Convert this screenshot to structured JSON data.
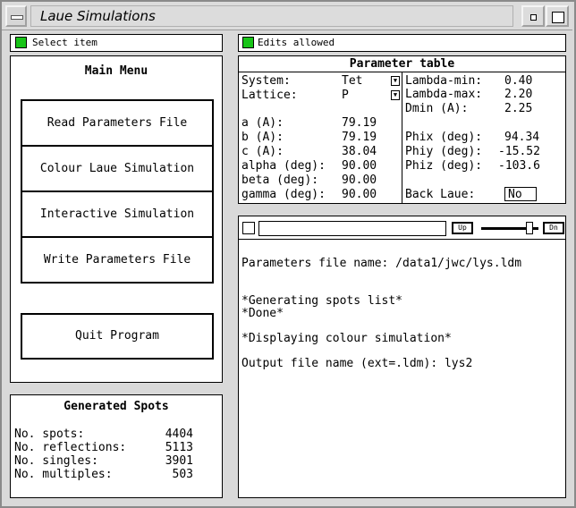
{
  "window": {
    "title": "Laue Simulations"
  },
  "left_status": {
    "text": "Select item",
    "color": "#18c418"
  },
  "right_status": {
    "text": "Edits allowed",
    "color": "#18c418"
  },
  "main_menu": {
    "title": "Main Menu",
    "buttons": [
      "Read Parameters File",
      "Colour Laue Simulation",
      "Interactive Simulation",
      "Write Parameters File"
    ],
    "quit": "Quit Program"
  },
  "generated_spots": {
    "title": "Generated Spots",
    "rows": [
      {
        "label": "No. spots:",
        "value": "4404"
      },
      {
        "label": "No. reflections:",
        "value": "5113"
      },
      {
        "label": "No. singles:",
        "value": "3901"
      },
      {
        "label": "No. multiples:",
        "value": "503"
      }
    ]
  },
  "parameter_table": {
    "title": "Parameter table",
    "system": {
      "label": "System:",
      "value": "Tet"
    },
    "lattice": {
      "label": "Lattice:",
      "value": "P"
    },
    "cell": [
      {
        "label": "a (A):",
        "value": "79.19"
      },
      {
        "label": "b (A):",
        "value": "79.19"
      },
      {
        "label": "c (A):",
        "value": "38.04"
      },
      {
        "label": "alpha (deg):",
        "value": "90.00"
      },
      {
        "label": "beta (deg):",
        "value": "90.00"
      },
      {
        "label": "gamma (deg):",
        "value": "90.00"
      }
    ],
    "lambda": [
      {
        "label": "Lambda-min:",
        "value": "0.40"
      },
      {
        "label": "Lambda-max:",
        "value": "2.20"
      },
      {
        "label": "Dmin (A):",
        "value": "2.25"
      }
    ],
    "phi": [
      {
        "label": "Phix (deg):",
        "value": "94.34"
      },
      {
        "label": "Phiy (deg):",
        "value": "-15.52"
      },
      {
        "label": "Phiz (deg):",
        "value": "-103.6"
      }
    ],
    "back_laue": {
      "label": "Back Laue:",
      "value": "No"
    }
  },
  "console": {
    "up_label": "Up",
    "down_label": "Dn",
    "slider_level": 0.9,
    "lines": [
      "Parameters file name: /data1/jwc/lys.ldm",
      "",
      "*Generating spots list*",
      "*Done*",
      "",
      "*Displaying colour simulation*",
      "",
      "Output file name (ext=.ldm): lys2"
    ]
  }
}
